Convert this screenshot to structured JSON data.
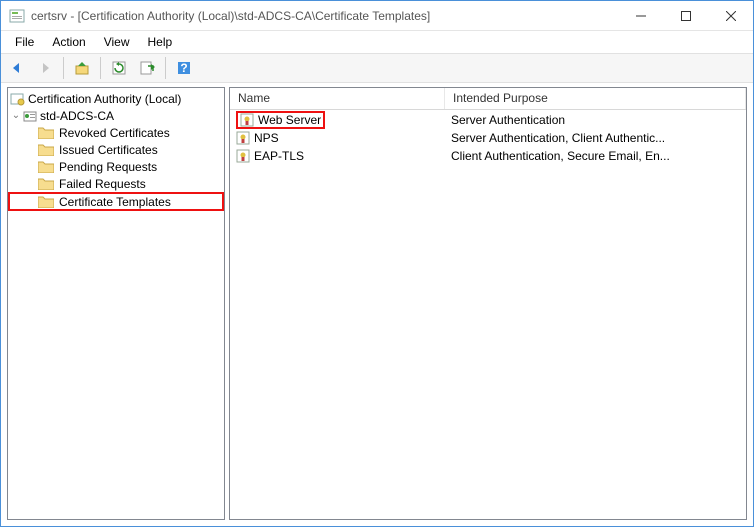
{
  "window": {
    "title": "certsrv - [Certification Authority (Local)\\std-ADCS-CA\\Certificate Templates]"
  },
  "menu": {
    "file": "File",
    "action": "Action",
    "view": "View",
    "help": "Help"
  },
  "tree": {
    "root": "Certification Authority (Local)",
    "ca": "std-ADCS-CA",
    "items": [
      "Revoked Certificates",
      "Issued Certificates",
      "Pending Requests",
      "Failed Requests",
      "Certificate Templates"
    ]
  },
  "columns": {
    "name": "Name",
    "purpose": "Intended Purpose"
  },
  "rows": [
    {
      "name": "Web Server",
      "purpose": "Server Authentication",
      "highlight": true
    },
    {
      "name": "NPS",
      "purpose": "Server Authentication, Client Authentic..."
    },
    {
      "name": "EAP-TLS",
      "purpose": "Client Authentication, Secure Email, En..."
    }
  ]
}
